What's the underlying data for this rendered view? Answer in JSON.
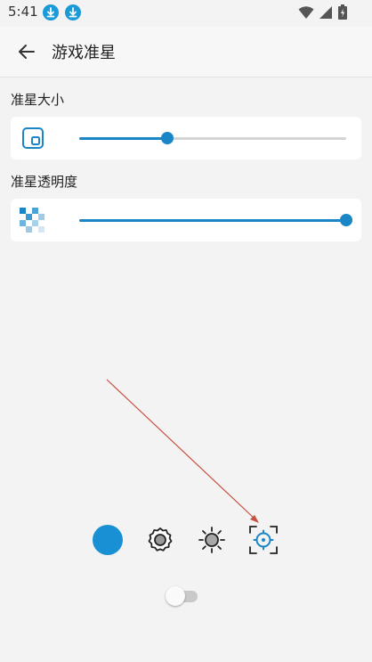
{
  "status_bar": {
    "time": "5:41",
    "notification_icons": [
      "download-icon",
      "download-icon"
    ],
    "system_icons": [
      "wifi-icon",
      "signal-icon",
      "battery-icon"
    ],
    "accent": "#1a9ad6"
  },
  "app_bar": {
    "title": "游戏准星",
    "back_icon": "arrow-left-icon"
  },
  "crosshair_size": {
    "label": "准星大小",
    "icon": "crosshair-size-icon",
    "value": 0.33
  },
  "crosshair_opacity": {
    "label": "准星透明度",
    "icon": "transparency-checker-icon",
    "value": 1.0
  },
  "bottom_toolbar": {
    "items": [
      {
        "name": "color-swatch",
        "color": "#1a90d4"
      },
      {
        "name": "settings-gear-icon"
      },
      {
        "name": "brightness-icon"
      },
      {
        "name": "crosshair-target-icon"
      }
    ]
  },
  "toggle": {
    "enabled": false
  },
  "colors": {
    "accent": "#1a86c5",
    "background": "#f3f3f3",
    "card": "#ffffff",
    "annotation_arrow": "#c8503f"
  }
}
